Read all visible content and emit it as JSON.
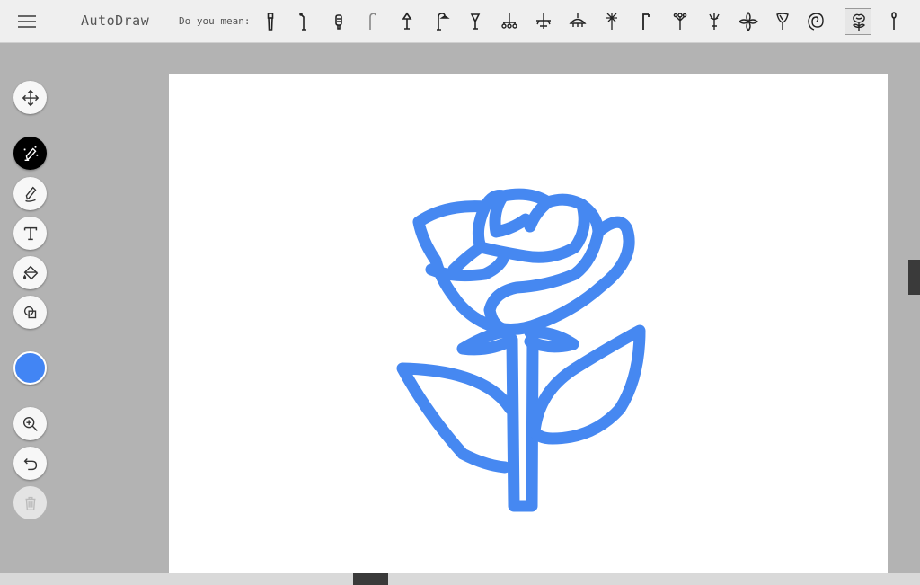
{
  "header": {
    "menu_icon": "hamburger-menu-icon",
    "title": "AutoDraw",
    "suggest_label": "Do you mean:"
  },
  "suggestions": [
    {
      "name": "flashlight",
      "selected": false
    },
    {
      "name": "street-lamp",
      "selected": false
    },
    {
      "name": "lantern",
      "selected": false
    },
    {
      "name": "curved-streetlight",
      "selected": false
    },
    {
      "name": "table-lamp",
      "selected": false
    },
    {
      "name": "hook-lamp",
      "selected": false
    },
    {
      "name": "goblet",
      "selected": false
    },
    {
      "name": "chandelier",
      "selected": false
    },
    {
      "name": "ceiling-lamp",
      "selected": false
    },
    {
      "name": "pendant-light",
      "selected": false
    },
    {
      "name": "dandelion",
      "selected": false
    },
    {
      "name": "lamp-post",
      "selected": false
    },
    {
      "name": "tulip-sprig",
      "selected": false
    },
    {
      "name": "lily",
      "selected": false
    },
    {
      "name": "flower",
      "selected": false
    },
    {
      "name": "calla-lily",
      "selected": false
    },
    {
      "name": "spiral-rose",
      "selected": false
    },
    {
      "name": "rose",
      "selected": true
    },
    {
      "name": "single-stem-flower",
      "selected": false
    }
  ],
  "tools": [
    {
      "name": "move-tool",
      "icon": "move-arrows-icon",
      "active": false
    },
    {
      "name": "autodraw-tool",
      "icon": "magic-pen-icon",
      "active": true
    },
    {
      "name": "draw-tool",
      "icon": "pencil-icon",
      "active": false
    },
    {
      "name": "type-tool",
      "icon": "text-t-icon",
      "active": false
    },
    {
      "name": "fill-tool",
      "icon": "paint-bucket-icon",
      "active": false
    },
    {
      "name": "shape-tool",
      "icon": "shapes-icon",
      "active": false
    },
    {
      "name": "color-picker",
      "icon": "color-swatch",
      "active": false
    },
    {
      "name": "zoom-tool",
      "icon": "zoom-in-icon",
      "active": false
    },
    {
      "name": "undo-tool",
      "icon": "undo-icon",
      "active": false
    },
    {
      "name": "delete-tool",
      "icon": "trash-icon",
      "active": false,
      "disabled": true
    }
  ],
  "colors": {
    "current": "#4285f4",
    "stroke": "#4688f1",
    "active_tool": "#000000",
    "canvas": "#ffffff",
    "workspace": "#b3b3b3"
  },
  "canvas": {
    "drawing": "rose"
  }
}
